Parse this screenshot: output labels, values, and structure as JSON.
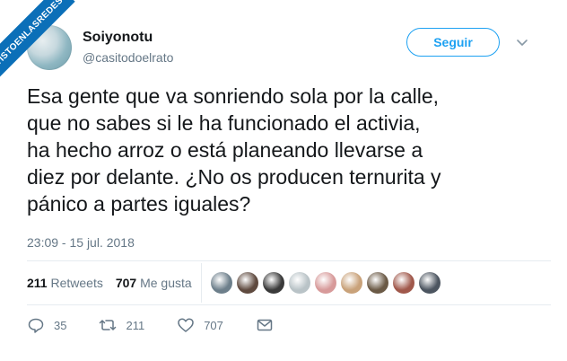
{
  "watermark": {
    "text": "VISTOENLASREDES"
  },
  "profile": {
    "display_name": "Soiyonotu",
    "handle": "@casitodoelrato"
  },
  "header": {
    "follow_label": "Seguir"
  },
  "tweet": {
    "lines": [
      "Esa gente que va sonriendo sola por la calle,",
      "que no sabes si le ha funcionado el activia,",
      "ha hecho arroz o está planeando llevarse a",
      "diez por delante. ¿No os producen ternurita y",
      "pánico a partes iguales?"
    ],
    "timestamp": "23:09 - 15 jul. 2018"
  },
  "stats": {
    "retweets_count": "211",
    "retweets_label": "Retweets",
    "likes_count": "707",
    "likes_label": "Me gusta"
  },
  "liker_avatars": [
    {
      "icon": "default-profile-icon",
      "color": "#6d7f8b"
    },
    {
      "icon": "user-avatar",
      "color": "#5f4a3f"
    },
    {
      "icon": "user-avatar",
      "color": "#3a3a3a"
    },
    {
      "icon": "user-avatar",
      "color": "#b9c3c7"
    },
    {
      "icon": "user-avatar",
      "color": "#d79a9a"
    },
    {
      "icon": "user-avatar",
      "color": "#c9a27a"
    },
    {
      "icon": "user-avatar",
      "color": "#6b5a46"
    },
    {
      "icon": "user-avatar",
      "color": "#a0584b"
    },
    {
      "icon": "user-avatar",
      "color": "#4c5560"
    }
  ],
  "actions": {
    "reply_count": "35",
    "retweet_count": "211",
    "like_count": "707"
  },
  "colors": {
    "accent": "#1da1f2",
    "muted": "#657786",
    "text": "#14171a",
    "watermark": "#0b6fb8"
  }
}
